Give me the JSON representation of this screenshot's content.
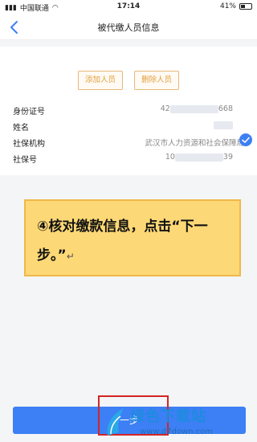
{
  "status_bar": {
    "carrier": "中国联通",
    "time": "17:14",
    "battery": "41%"
  },
  "nav": {
    "title": "被代缴人员信息"
  },
  "actions": {
    "add_label": "添加人员",
    "delete_label": "删除人员"
  },
  "info": [
    {
      "label": "身份证号",
      "value_prefix": "42",
      "value_suffix": "668"
    },
    {
      "label": "姓名",
      "value_prefix": "",
      "value_suffix": ""
    },
    {
      "label": "社保机构",
      "value_prefix": "武汉市人力资源和社会保障局",
      "value_suffix": ""
    },
    {
      "label": "社保号",
      "value_prefix": "10",
      "value_suffix": "39"
    }
  ],
  "callout": {
    "text": "④核对缴款信息，点击“下一步。”",
    "mark": "↵"
  },
  "next_button": {
    "label": "一步"
  },
  "watermark": {
    "title": "绿色下载站",
    "url": "www.d7down.com"
  },
  "colors": {
    "primary": "#3d7ff5",
    "accent_orange": "#e0a040",
    "callout_bg": "#fdd876",
    "highlight_red": "#d42525"
  }
}
